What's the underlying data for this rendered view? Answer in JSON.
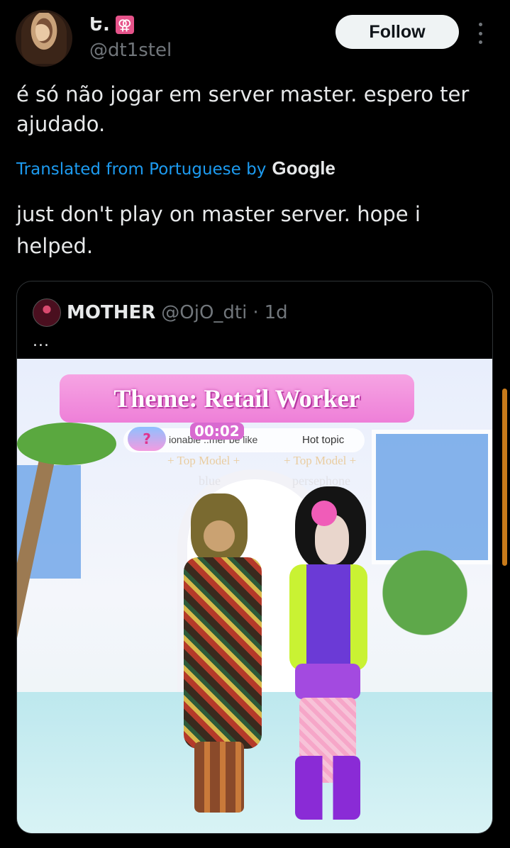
{
  "author": {
    "display_name": "Ե.",
    "emoji": "⚢",
    "handle": "@dt1stel",
    "avatar_icon": "profile-photo"
  },
  "actions": {
    "follow_label": "Follow",
    "more_icon": "vertical-ellipsis"
  },
  "tweet": {
    "text": "é só não jogar em server master. espero ter ajudado.",
    "translated_from": "Translated from Portuguese by",
    "translator_logo": "Google",
    "translation": "just don't play on master server. hope i helped."
  },
  "quoted": {
    "display_name": "MOTHER",
    "handle": "@OjO_dti",
    "separator": "·",
    "time": "1d",
    "more": "...",
    "media": {
      "theme": "Theme: Retail Worker",
      "timer": "00:02",
      "prompt": "ionable ..mer be like",
      "hot_topic": "Hot topic",
      "tags": [
        "+ Top Model +",
        "+ Top Model +"
      ],
      "player_names": [
        "blue",
        "persephone"
      ]
    }
  },
  "colors": {
    "accent_link": "#1d9bf0",
    "muted": "#71767b",
    "background": "#000000",
    "follow_bg": "#eff3f4"
  }
}
